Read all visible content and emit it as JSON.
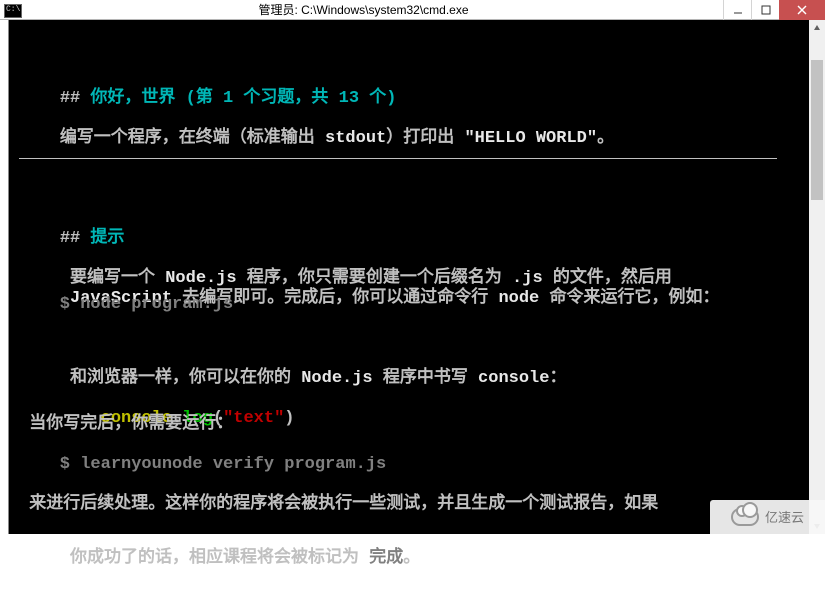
{
  "window": {
    "title": "管理员: C:\\Windows\\system32\\cmd.exe"
  },
  "content": {
    "h1_prefix": "## ",
    "h1": "你好，世界 (第 1 个习题，共 13 个)",
    "task_a": "编写一个程序，在终端（标准输出 ",
    "task_stdout": "stdout",
    "task_b": "）打印出 ",
    "task_hello": "\"HELLO WORLD\"",
    "task_c": "。",
    "h2_prefix": "## ",
    "h2": "提示",
    "p1_a": " 要编写一个 ",
    "p1_node": "Node.js",
    "p1_b": " 程序，你只需要创建一个后缀名为 ",
    "p1_js": ".js",
    "p1_c": " 的文件，然后用",
    "p2_a": " ",
    "p2_js": "JavaScript",
    "p2_b": " 去编写即可。完成后，你可以通过命令行 ",
    "p2_node": "node",
    "p2_c": " 命令来运行它，例如：",
    "cmd1": "    $ node program.js",
    "p3_a": " 和浏览器一样，你可以在你的 ",
    "p3_node": "Node.js",
    "p3_b": " 程序中书写 ",
    "p3_console": "console",
    "p3_c": "：",
    "code_indent": "    ",
    "code_console": "console",
    "code_dot1": ".",
    "code_log": "log",
    "code_paren1": "(",
    "code_text": "\"text\"",
    "code_paren2": ")",
    "p4": " 当你写完后，你需要运行：",
    "cmd2": "    $ learnyounode verify program.js",
    "p5_a": " 来进行后续处理。这样你的程序将会被执行一些测试，并且生成一个测试报告，如果",
    "p6_a": " 你成功了的话，相应课程将会被标记为 ",
    "p6_done": "完成",
    "p6_b": "。"
  },
  "watermark": "亿速云"
}
